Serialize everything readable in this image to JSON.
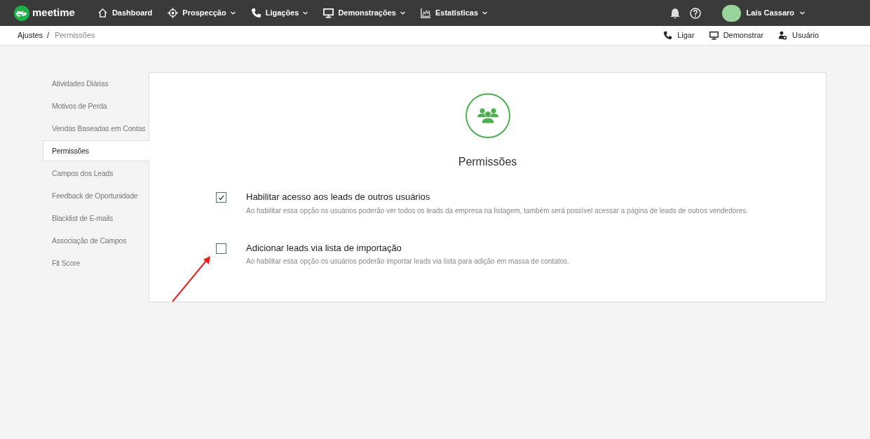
{
  "topbar": {
    "brand": "meetime",
    "nav": [
      {
        "label": "Dashboard"
      },
      {
        "label": "Prospecção"
      },
      {
        "label": "Ligações"
      },
      {
        "label": "Demonstrações"
      },
      {
        "label": "Estatísticas"
      }
    ],
    "user": {
      "name": "Laís Cassaro"
    }
  },
  "breadcrumb": [
    "Ajustes",
    "/",
    "Permissões"
  ],
  "actions": [
    {
      "label": "Ligar"
    },
    {
      "label": "Demonstrar"
    },
    {
      "label": "Usuário"
    }
  ],
  "sidebar": {
    "items": [
      {
        "label": "Atividades Diárias",
        "selected": false
      },
      {
        "label": "Motivos de Perda",
        "selected": false
      },
      {
        "label": "Vendas Baseadas em Contas",
        "selected": false
      },
      {
        "label": "Permissões",
        "selected": true
      },
      {
        "label": "Campos dos Leads",
        "selected": false
      },
      {
        "label": "Feedback de Oportunidade",
        "selected": false
      },
      {
        "label": "Blacklist de E-mails",
        "selected": false
      },
      {
        "label": "Associação de Campos",
        "selected": false
      },
      {
        "label": "Fit Score",
        "selected": false
      }
    ]
  },
  "panel": {
    "title": "Permissões",
    "options": [
      {
        "label": "Habilitar acesso aos leads de outros usuários",
        "description": "Ao habilitar essa opção os usuários poderão ver todos os leads da empresa na listagem, também será possível acessar a página de leads de outros vendedores.",
        "checked": true
      },
      {
        "label": "Adicionar leads via lista de importação",
        "description": "Ao habilitar essa opção os usuários poderão importar leads via lista para adição em massa de contatos.",
        "checked": false
      }
    ]
  }
}
